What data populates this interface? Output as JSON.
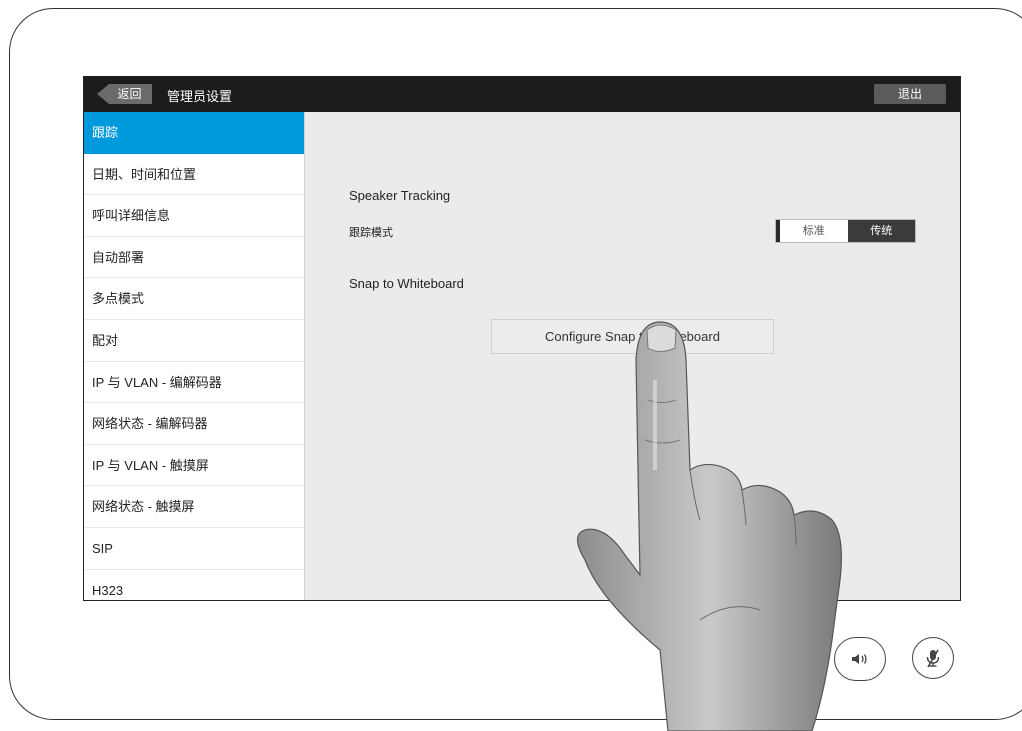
{
  "header": {
    "back_label": "返回",
    "title": "管理员设置",
    "exit_label": "退出"
  },
  "sidebar": {
    "items": [
      {
        "label": "跟踪",
        "active": true
      },
      {
        "label": "日期、时间和位置"
      },
      {
        "label": "呼叫详细信息"
      },
      {
        "label": "自动部署"
      },
      {
        "label": "多点模式"
      },
      {
        "label": "配对"
      },
      {
        "label": "IP 与 VLAN - 编解码器"
      },
      {
        "label": "网络状态 - 编解码器"
      },
      {
        "label": "IP 与 VLAN - 触摸屏"
      },
      {
        "label": "网络状态 - 触摸屏"
      },
      {
        "label": "SIP"
      },
      {
        "label": "H323"
      }
    ]
  },
  "main": {
    "speaker_tracking_title": "Speaker Tracking",
    "tracking_mode_label": "跟踪模式",
    "mode_options": [
      "标准",
      "传统"
    ],
    "mode_selected": "传统",
    "snap_title": "Snap to Whiteboard",
    "configure_button_label": "Configure Snap to Whiteboard"
  },
  "device_controls": {
    "volume_icon": "speaker-volume-icon",
    "mute_icon": "microphone-muted-icon"
  },
  "colors": {
    "accent": "#0099dc",
    "topbar": "#1c1c1c",
    "selected_segment": "#3b3b3b"
  }
}
